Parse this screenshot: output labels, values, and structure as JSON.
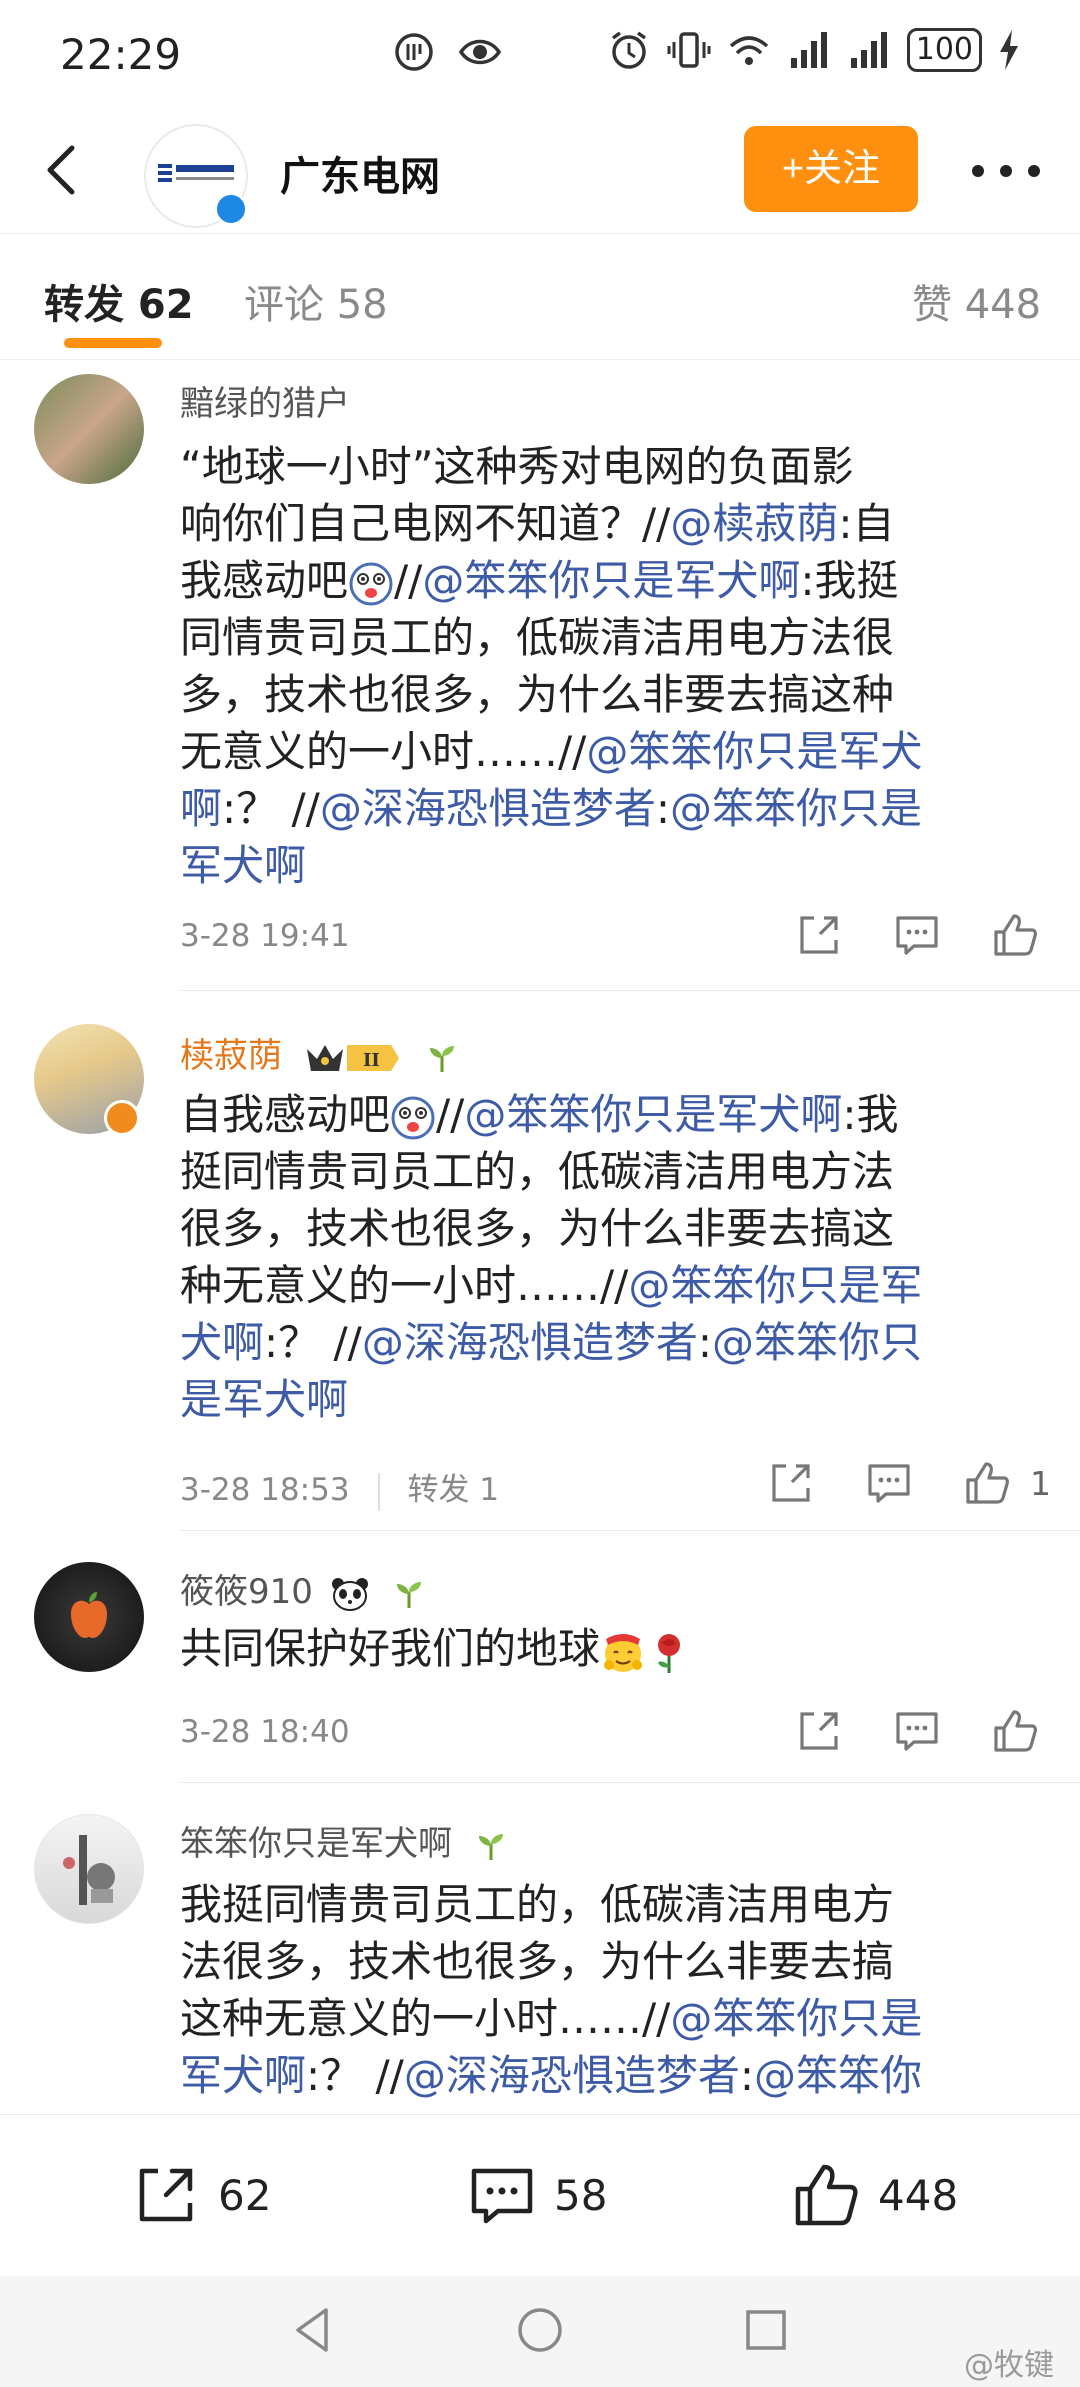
{
  "status_bar": {
    "time": "22:29",
    "battery": "100"
  },
  "header": {
    "account_name": "广东电网",
    "follow_label": "+关注"
  },
  "tabs": [
    {
      "label": "转发 62"
    },
    {
      "label": "评论 58"
    },
    {
      "label": "赞 448"
    }
  ],
  "comments": [
    {
      "username": "黯绿的猎户",
      "text_lines": [
        [
          {
            "t": "“地球一小时”这种秀对电网的负面影"
          }
        ],
        [
          {
            "t": "响你们自己电网不知道？//"
          },
          {
            "t": "@椟菽荫",
            "m": true
          },
          {
            "t": ":自"
          }
        ],
        [
          {
            "t": "我感动吧"
          },
          {
            "t": "[emoji]",
            "e": "face"
          },
          {
            "t": "//"
          },
          {
            "t": "@笨笨你只是军犬啊",
            "m": true
          },
          {
            "t": ":我挺"
          }
        ],
        [
          {
            "t": "同情贵司员工的，低碳清洁用电方法很"
          }
        ],
        [
          {
            "t": "多，技术也很多，为什么非要去搞这种"
          }
        ],
        [
          {
            "t": "无意义的一小时……//"
          },
          {
            "t": "@笨笨你只是军犬",
            "m": true
          }
        ],
        [
          {
            "t": "啊",
            "m": true
          },
          {
            "t": ":？ //"
          },
          {
            "t": "@深海恐惧造梦者",
            "m": true
          },
          {
            "t": ":"
          },
          {
            "t": "@笨笨你只是",
            "m": true
          }
        ],
        [
          {
            "t": "军犬啊",
            "m": true
          }
        ]
      ],
      "time": "3-28 19:41",
      "repost": "",
      "likes": ""
    },
    {
      "username": "椟菽荫",
      "text_lines": [
        [
          {
            "t": "自我感动吧"
          },
          {
            "t": "[emoji]",
            "e": "face"
          },
          {
            "t": "//"
          },
          {
            "t": "@笨笨你只是军犬啊",
            "m": true
          },
          {
            "t": ":我"
          }
        ],
        [
          {
            "t": "挺同情贵司员工的，低碳清洁用电方法"
          }
        ],
        [
          {
            "t": "很多，技术也很多，为什么非要去搞这"
          }
        ],
        [
          {
            "t": "种无意义的一小时……//"
          },
          {
            "t": "@笨笨你只是军",
            "m": true
          }
        ],
        [
          {
            "t": "犬啊",
            "m": true
          },
          {
            "t": ":？ //"
          },
          {
            "t": "@深海恐惧造梦者",
            "m": true
          },
          {
            "t": ":"
          },
          {
            "t": "@笨笨你只",
            "m": true
          }
        ],
        [
          {
            "t": "是军犬啊",
            "m": true
          }
        ]
      ],
      "time": "3-28 18:53",
      "repost": "转发 1",
      "likes": "1"
    },
    {
      "username": "筱筱910",
      "text_lines": [
        [
          {
            "t": "共同保护好我们的地球"
          },
          {
            "t": "[emoji]",
            "e": "hug"
          },
          {
            "t": "[rose]",
            "e": "rose"
          }
        ]
      ],
      "time": "3-28 18:40",
      "repost": "",
      "likes": ""
    },
    {
      "username": "笨笨你只是军犬啊",
      "text_lines": [
        [
          {
            "t": "我挺同情贵司员工的，低碳清洁用电方"
          }
        ],
        [
          {
            "t": "法很多，技术也很多，为什么非要去搞"
          }
        ],
        [
          {
            "t": "这种无意义的一小时……//"
          },
          {
            "t": "@笨笨你只是",
            "m": true
          }
        ],
        [
          {
            "t": "军犬啊",
            "m": true
          },
          {
            "t": ":？ //"
          },
          {
            "t": "@深海恐惧造梦者",
            "m": true
          },
          {
            "t": ":"
          },
          {
            "t": "@笨笨你",
            "m": true
          }
        ]
      ],
      "time": "",
      "repost": "",
      "likes": ""
    }
  ],
  "bottom_bar": {
    "reposts": "62",
    "comments": "58",
    "likes": "448"
  },
  "watermark": "@牧键",
  "colors": {
    "accent": "#ff8f0f",
    "mention": "#3d5ba6",
    "orange_name": "#e5781b"
  }
}
